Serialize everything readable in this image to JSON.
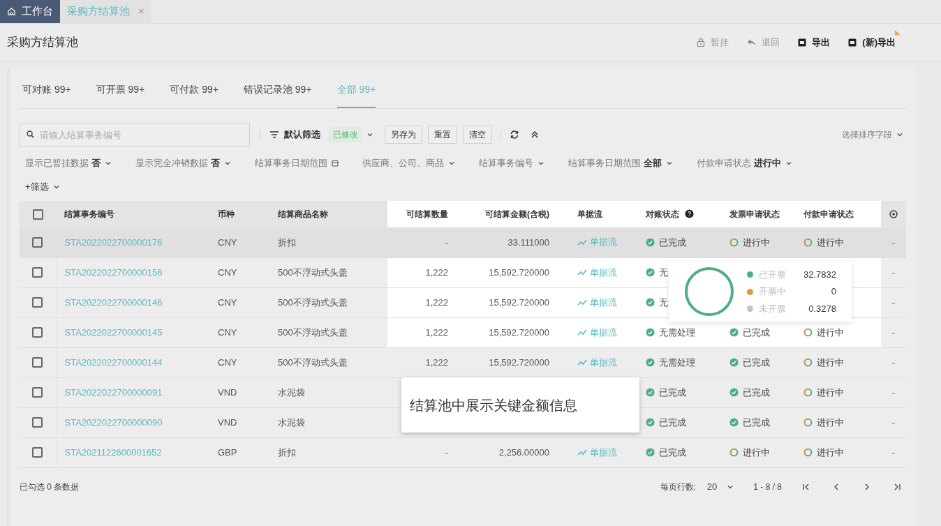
{
  "window_tabs": [
    {
      "kind": "home",
      "label": "工作台",
      "selected": false
    },
    {
      "kind": "page",
      "label": "采购方结算池",
      "selected": true,
      "close": "×"
    }
  ],
  "page_title": "采购方结算池",
  "actions": [
    {
      "kind": "lock",
      "label": "暂挂",
      "disabled": true
    },
    {
      "kind": "return",
      "label": "退回",
      "disabled": true
    },
    {
      "kind": "export",
      "label": "导出",
      "disabled": false
    },
    {
      "kind": "export",
      "label": "(新)导出",
      "disabled": false,
      "flag": true
    }
  ],
  "tabs": [
    {
      "label": "可对账",
      "count": "99+",
      "selected": false
    },
    {
      "label": "可开票",
      "count": "99+",
      "selected": false
    },
    {
      "label": "可付款",
      "count": "99+",
      "selected": false
    },
    {
      "label": "错误记录池",
      "count": "99+",
      "selected": false
    },
    {
      "label": "全部",
      "count": "99+",
      "selected": true
    }
  ],
  "search": {
    "placeholder": "请输入结算事务编号"
  },
  "filter_preset": {
    "label": "默认筛选",
    "badge": "已修改"
  },
  "toolbar_buttons": [
    "另存为",
    "重置",
    "清空"
  ],
  "sort": {
    "label": "选择排序字段"
  },
  "filters": [
    {
      "kind": "dropdown",
      "label": "显示已暂挂数据",
      "value": "否"
    },
    {
      "kind": "dropdown",
      "label": "显示完全冲销数据",
      "value": "否"
    },
    {
      "kind": "date",
      "label": "结算事务日期范围"
    },
    {
      "kind": "dropdown",
      "label": "供应商、公司、商品"
    },
    {
      "kind": "dropdown",
      "label": "结算事务编号"
    },
    {
      "kind": "dropdown",
      "label": "结算事务日期范围",
      "value": "全部"
    },
    {
      "kind": "dropdown",
      "label": "付款申请状态",
      "value": "进行中"
    }
  ],
  "add_filter": "+筛选",
  "table": {
    "header_highlighted": true,
    "all_checked": false,
    "columns": [
      "结算事务编号",
      "币种",
      "结算商品名称",
      "可结算数量",
      "可结算金额(含税)",
      "单据流",
      "对账状态",
      "发票申请状态",
      "付款申请状态"
    ],
    "rows": [
      {
        "checked": false,
        "hovered": true,
        "highlighted": false,
        "id": "STA2022022700000176",
        "currency": "CNY",
        "product": "折扣",
        "qty": "-",
        "amount": "33.111000",
        "flow": "单据流",
        "recon": {
          "kind": "done",
          "label": "已完成"
        },
        "invoice": {
          "kind": "progress",
          "label": "进行中"
        },
        "payment": {
          "kind": "progress",
          "label": "进行中"
        },
        "extra": "-"
      },
      {
        "checked": false,
        "hovered": false,
        "highlighted": true,
        "id": "STA2022022700000156",
        "currency": "CNY",
        "product": "500不浮动式头盖",
        "qty": "1,222",
        "amount": "15,592.720000",
        "flow": "单据流",
        "recon": {
          "kind": "done",
          "label": "无"
        },
        "extra": "-"
      },
      {
        "checked": false,
        "hovered": false,
        "highlighted": true,
        "id": "STA2022022700000146",
        "currency": "CNY",
        "product": "500不浮动式头盖",
        "qty": "1,222",
        "amount": "15,592.720000",
        "flow": "单据流",
        "recon": {
          "kind": "done",
          "label": "无"
        },
        "extra": "-"
      },
      {
        "checked": false,
        "hovered": false,
        "highlighted": true,
        "id": "STA2022022700000145",
        "currency": "CNY",
        "product": "500不浮动式头盖",
        "qty": "1,222",
        "amount": "15,592.720000",
        "flow": "单据流",
        "recon": {
          "kind": "done",
          "label": "无需处理"
        },
        "invoice": {
          "kind": "done",
          "label": "已完成"
        },
        "payment": {
          "kind": "progress",
          "label": "进行中"
        },
        "extra": "-"
      },
      {
        "checked": false,
        "hovered": false,
        "highlighted": false,
        "id": "STA2022022700000144",
        "currency": "CNY",
        "product": "500不浮动式头盖",
        "qty": "1,222",
        "amount": "15,592.720000",
        "flow": "单据流",
        "recon": {
          "kind": "done",
          "label": "无需处理"
        },
        "invoice": {
          "kind": "done",
          "label": "已完成"
        },
        "payment": {
          "kind": "progress",
          "label": "进行中"
        },
        "extra": "-"
      },
      {
        "checked": false,
        "hovered": false,
        "highlighted": false,
        "id": "STA2022022700000091",
        "currency": "VND",
        "product": "水泥袋",
        "recon": {
          "kind": "done",
          "label": "已完成"
        },
        "invoice": {
          "kind": "done",
          "label": "已完成"
        },
        "payment": {
          "kind": "progress",
          "label": "进行中"
        },
        "extra": "-"
      },
      {
        "checked": false,
        "hovered": false,
        "highlighted": false,
        "id": "STA2022022700000090",
        "currency": "VND",
        "product": "水泥袋",
        "recon": {
          "kind": "done",
          "label": "已完成"
        },
        "invoice": {
          "kind": "done",
          "label": "已完成"
        },
        "payment": {
          "kind": "progress",
          "label": "进行中"
        },
        "extra": "-"
      },
      {
        "checked": false,
        "hovered": false,
        "highlighted": false,
        "id": "STA2021122600001652",
        "currency": "GBP",
        "product": "折扣",
        "qty": "-",
        "amount": "2,256.00000",
        "flow": "单据流",
        "recon": {
          "kind": "done",
          "label": "已完成"
        },
        "invoice": {
          "kind": "progress",
          "label": "进行中"
        },
        "payment": {
          "kind": "progress",
          "label": "进行中"
        },
        "extra": "-"
      }
    ]
  },
  "invoice_popup": {
    "legend": [
      {
        "label": "已开票",
        "value": "32.7832",
        "color": "#4caf7d"
      },
      {
        "label": "开票中",
        "value": "0",
        "color": "#e8963a"
      },
      {
        "label": "未开票",
        "value": "0.3278",
        "color": "#c4c4c4"
      }
    ]
  },
  "callout": "结算池中展示关键金额信息",
  "footer": {
    "selected_text": "已勾选 0 条数据",
    "page_size_label": "每页行数:",
    "page_size": "20",
    "range": "1 - 8 / 8"
  }
}
